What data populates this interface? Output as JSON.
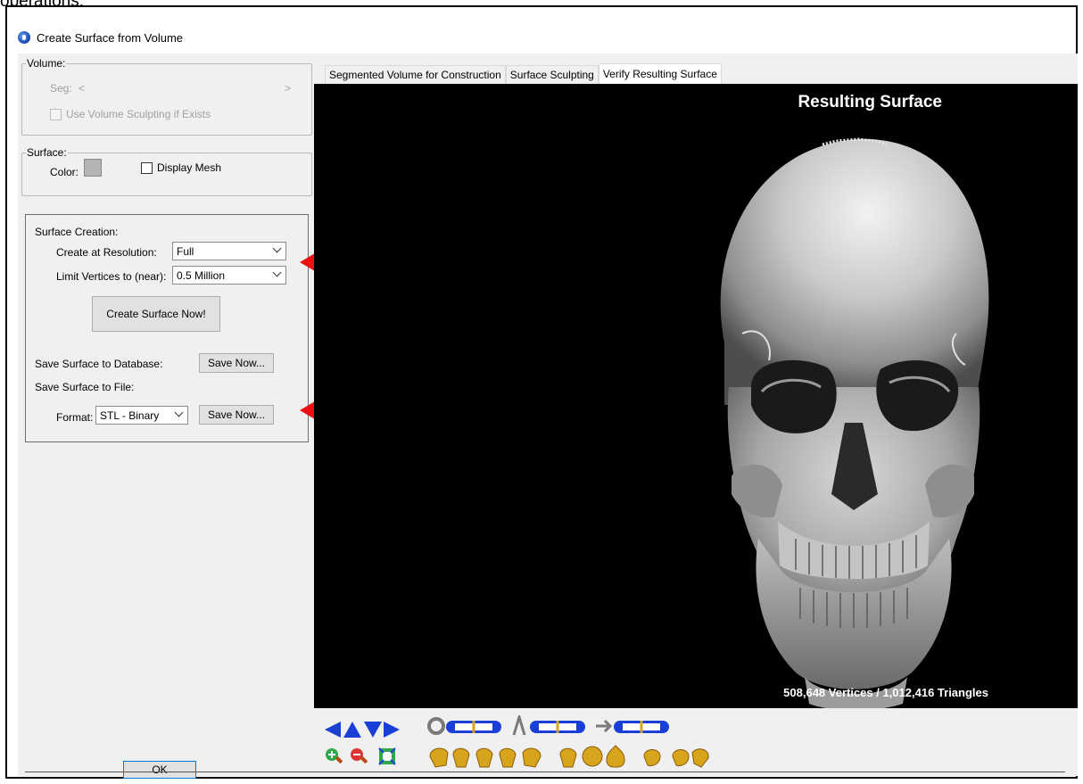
{
  "caption": {
    "text": "operations."
  },
  "window": {
    "title": "Create Surface from Volume"
  },
  "volume_group": {
    "legend": "Volume:",
    "seg_label": "Seg:",
    "seg_prev": "<",
    "seg_next": ">",
    "use_sculpting_label": "Use Volume Sculpting if Exists"
  },
  "surface_group": {
    "legend": "Surface:",
    "color_label": "Color:",
    "color_value": "#b4b4b4",
    "display_mesh_label": "Display Mesh"
  },
  "surface_creation": {
    "heading": "Surface Creation:",
    "resolution_label": "Create at Resolution:",
    "resolution_value": "Full",
    "vertices_label": "Limit Vertices to (near):",
    "vertices_value": "0.5 Million",
    "create_button": "Create Surface Now!",
    "save_db_label": "Save Surface to Database:",
    "save_db_button": "Save Now...",
    "save_file_label": "Save Surface to File:",
    "format_label": "Format:",
    "format_value": "STL - Binary",
    "save_file_button": "Save Now..."
  },
  "footer": {
    "ok_button": "OK"
  },
  "tabs": [
    {
      "label": "Segmented Volume for Construction",
      "active": false
    },
    {
      "label": "Surface Sculpting",
      "active": false
    },
    {
      "label": "Verify Resulting Surface",
      "active": true
    }
  ],
  "viewport": {
    "title": "Resulting Surface",
    "stats": "508,648 Vertices / 1,012,416 Triangles"
  },
  "colors": {
    "annotation_arrow": "#ee1111",
    "toolbar_blue": "#1a3fd6",
    "toolbar_gold": "#d8a41c"
  }
}
